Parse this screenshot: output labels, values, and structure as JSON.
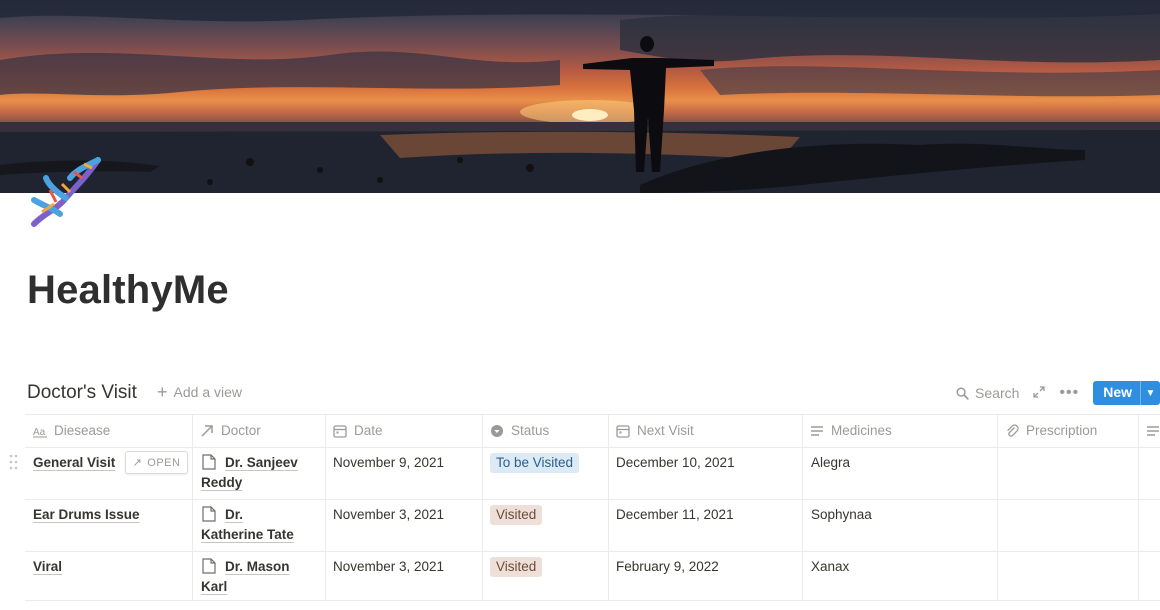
{
  "page": {
    "title": "HealthyMe",
    "icon": "dna-icon"
  },
  "database": {
    "title": "Doctor's Visit",
    "add_view_label": "Add a view",
    "search_label": "Search",
    "new_label": "New",
    "open_label": "OPEN",
    "columns": [
      {
        "label": "Diesease",
        "icon": "text-aa-icon"
      },
      {
        "label": "Doctor",
        "icon": "relation-arrow-icon"
      },
      {
        "label": "Date",
        "icon": "calendar-icon"
      },
      {
        "label": "Status",
        "icon": "select-circle-icon"
      },
      {
        "label": "Next Visit",
        "icon": "calendar-icon"
      },
      {
        "label": "Medicines",
        "icon": "text-lines-icon"
      },
      {
        "label": "Prescription",
        "icon": "paperclip-icon"
      }
    ],
    "rows": [
      {
        "disease": "General Visit",
        "doctor_line1": "Dr. Sanjeev",
        "doctor_line2": "Reddy",
        "date": "November 9, 2021",
        "status": "To be Visited",
        "next_visit": "December 10, 2021",
        "medicines": "Alegra",
        "prescription": ""
      },
      {
        "disease": "Ear Drums Issue",
        "doctor_line1": "Dr.",
        "doctor_line2": "Katherine Tate",
        "date": "November 3, 2021",
        "status": "Visited",
        "next_visit": "December 11, 2021",
        "medicines": "Sophynaa",
        "prescription": ""
      },
      {
        "disease": "Viral",
        "doctor_line1": "Dr. Mason",
        "doctor_line2": "Karl",
        "date": "November 3, 2021",
        "status": "Visited",
        "next_visit": "February 9, 2022",
        "medicines": "Xanax",
        "prescription": ""
      }
    ]
  },
  "colors": {
    "accent_blue": "#2f8ee0",
    "status_to_be_visited_bg": "#dbeaf5",
    "status_visited_bg": "#eee0d9",
    "text": "#37352f",
    "muted": "#9b9a97"
  }
}
